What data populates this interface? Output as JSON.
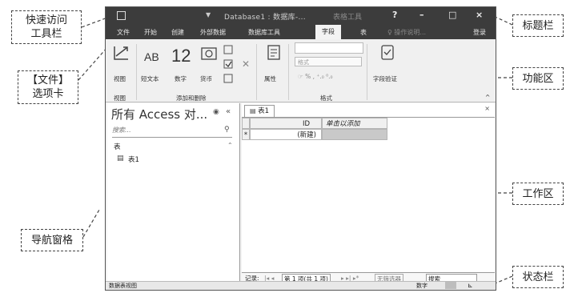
{
  "callouts": {
    "qat": [
      "快速访问",
      "工具栏"
    ],
    "file_tab": [
      "【文件】",
      "选项卡"
    ],
    "nav_pane": "导航窗格",
    "title_bar": "标题栏",
    "ribbon": "功能区",
    "work_area": "工作区",
    "status_bar": "状态栏"
  },
  "window": {
    "title": "Database1 : 数据库-...",
    "context_title": "表格工具",
    "help": "?",
    "minimize": "–",
    "maximize": "□",
    "close": "×",
    "qat_arrow": "▼"
  },
  "tabs": [
    "文件",
    "开始",
    "创建",
    "外部数据",
    "数据库工具",
    "字段",
    "表"
  ],
  "active_tab_index": 5,
  "tell_me": "♀ 操作说明...",
  "sign_in": "登录",
  "ribbon": {
    "view_label": "视图",
    "short_text_big": "AB",
    "short_text_label": "短文本",
    "number_big": "12",
    "number_label": "数字",
    "currency_label": "货币",
    "properties_label": "属性",
    "format_placeholder": "格式",
    "format_symbols": "☞ % ,  ⁺.₀ ⁰.₀",
    "validation_label": "字段验证",
    "group_views": "视图",
    "group_add_delete": "添加和删除",
    "group_format": "格式",
    "collapse": "^"
  },
  "nav_pane": {
    "title": "所有 Access 对...",
    "search_placeholder": "搜索...",
    "group_header": "表",
    "item": "表1"
  },
  "work_area": {
    "doc_tab": "表1",
    "doc_close": "×",
    "col_id": "ID",
    "col_add": "单击以添加",
    "new_row": "(新建)",
    "row_marker": "*"
  },
  "record_nav": {
    "label": "记录:",
    "position": "第 1 项(共 1 项)",
    "filter": "无筛选器",
    "search": "搜索"
  },
  "status_bar": {
    "left": "数据表视图",
    "right": "数字"
  }
}
